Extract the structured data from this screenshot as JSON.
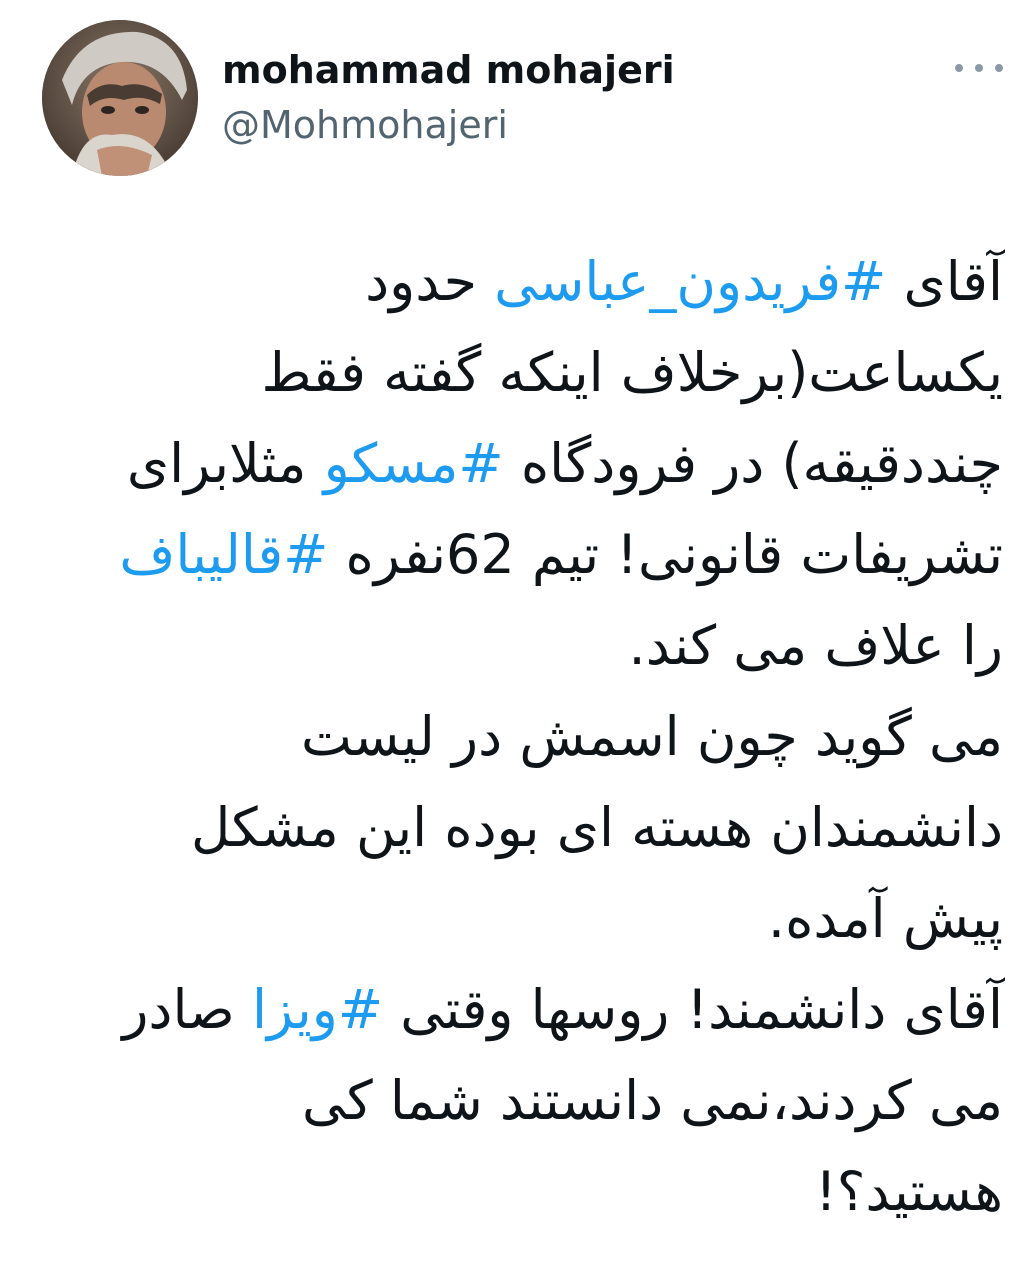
{
  "author": {
    "display_name": "mohammad mohajeri",
    "handle": "@Mohmohajeri"
  },
  "menu": {
    "icon": "more-horizontal-icon"
  },
  "tweet": {
    "lines": [
      {
        "before": "آقای ",
        "hashtag": "#فریدون_عباسی",
        "after": " حدود"
      },
      {
        "before": "یکساعت(برخلاف اینکه گفته فقط",
        "hashtag": "",
        "after": ""
      },
      {
        "before": "چنددقیقه) در فرودگاه ",
        "hashtag": "#مسکو",
        "after": " مثلابرای"
      },
      {
        "before": "تشریفات قانونی! تیم 62نفره ",
        "hashtag": "#قالیباف",
        "after": ""
      },
      {
        "before": "را علاف می کند.",
        "hashtag": "",
        "after": ""
      },
      {
        "before": "می گوید چون اسمش در لیست",
        "hashtag": "",
        "after": ""
      },
      {
        "before": "دانشمندان هسته ای بوده این مشکل",
        "hashtag": "",
        "after": ""
      },
      {
        "before": "پیش آمده.",
        "hashtag": "",
        "after": ""
      },
      {
        "before": "آقای دانشمند! روسها وقتی ",
        "hashtag": "#ویزا",
        "after": " صادر"
      },
      {
        "before": "می کردند،نمی دانستند شما کی",
        "hashtag": "",
        "after": ""
      },
      {
        "before": "هستید؟!",
        "hashtag": "",
        "after": ""
      }
    ]
  },
  "colors": {
    "hashtag": "#1d9bf0",
    "handle": "#536471",
    "text": "#0f1419"
  }
}
